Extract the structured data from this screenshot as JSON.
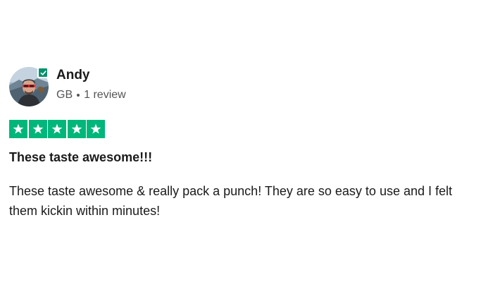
{
  "reviewer": {
    "name": "Andy",
    "country": "GB",
    "review_count": "1 review",
    "verified": true
  },
  "rating": {
    "stars": 5,
    "max": 5,
    "color": "#00b67a"
  },
  "review": {
    "title": "These taste awesome!!!",
    "body": "These taste awesome & really pack a punch! They are so easy to use and I felt them kickin within minutes!"
  },
  "icons": {
    "star": "star-icon",
    "verified": "check-icon"
  }
}
